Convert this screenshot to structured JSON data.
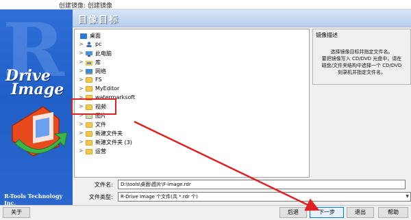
{
  "window": {
    "title": "创建镜像: 创建镜像"
  },
  "brand": {
    "big_letter": "R",
    "line1": "Drive",
    "line2": "Image",
    "company": "R-Tools Technology Inc."
  },
  "header": {
    "title": "目像目标"
  },
  "tree": {
    "items": [
      {
        "label": "桌面",
        "icon": "desktop-icon",
        "chevron": ""
      },
      {
        "label": "pc",
        "icon": "user-icon",
        "chevron": ">"
      },
      {
        "label": "此电脑",
        "icon": "computer-icon",
        "chevron": ">"
      },
      {
        "label": "库",
        "icon": "library-icon",
        "chevron": ">"
      },
      {
        "label": "网络",
        "icon": "network-icon",
        "chevron": ">"
      },
      {
        "label": "FS",
        "icon": "folder-icon",
        "chevron": ">"
      },
      {
        "label": "MyEditor",
        "icon": "folder-icon",
        "chevron": ">"
      },
      {
        "label": "watermarksoft",
        "icon": "folder-icon",
        "chevron": ">"
      },
      {
        "label": "视频",
        "icon": "folder-icon",
        "chevron": ">"
      },
      {
        "label": "图片",
        "icon": "folder-icon",
        "chevron": ">"
      },
      {
        "label": "文件",
        "icon": "folder-icon",
        "chevron": ">"
      },
      {
        "label": "新建文件夹",
        "icon": "folder-icon",
        "chevron": ">"
      },
      {
        "label": "新建文件夹 (3)",
        "icon": "folder-icon",
        "chevron": ">"
      },
      {
        "label": "运营",
        "icon": "folder-icon",
        "chevron": ">"
      }
    ]
  },
  "description": {
    "title": "镜像描述",
    "lines": [
      "选择镜像目标并指定文件名。",
      "要把镜像写入 CD/DVD 光盘中，请在",
      "磁盘/文件夹结构中选择一个 CD/DVD",
      "刻录机并指定文件名。"
    ]
  },
  "fields": {
    "filename_label": "文件名:",
    "filename_value": "D:\\tools\\桌面\\图片\\F-image.rdr",
    "filetype_label": "文件类型:",
    "filetype_value": "R-Drive Image 个文件(共 *.rdr 个)"
  },
  "buttons": {
    "about": "关于",
    "back": "后退",
    "next": "下一步",
    "exit": "退出",
    "help": "帮助"
  },
  "colors": {
    "brand_blue": "#2f6fd6",
    "annotation_red": "#e02020",
    "focus_blue": "#0078d7"
  }
}
